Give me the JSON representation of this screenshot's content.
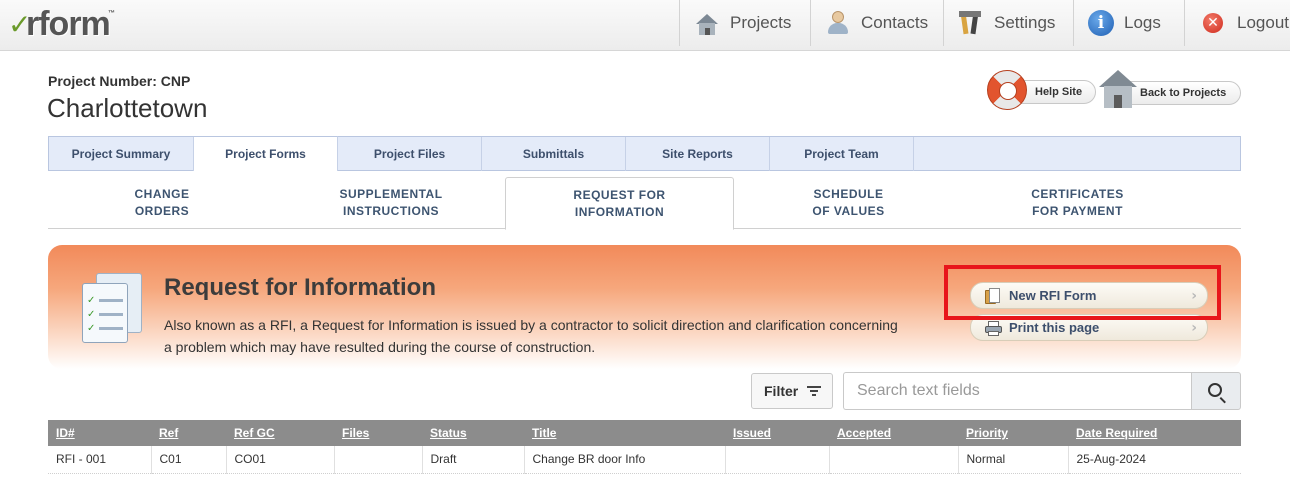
{
  "brand": {
    "name": "rform",
    "tm": "™"
  },
  "nav": [
    {
      "label": "Projects",
      "icon": "house-icon"
    },
    {
      "label": "Contacts",
      "icon": "person-icon"
    },
    {
      "label": "Settings",
      "icon": "tools-icon"
    },
    {
      "label": "Logs",
      "icon": "info-icon"
    },
    {
      "label": "Logout",
      "icon": "logout-icon"
    }
  ],
  "project": {
    "number_label": "Project Number: CNP",
    "name": "Charlottetown"
  },
  "header_buttons": {
    "help": "Help Site",
    "back": "Back to Projects"
  },
  "tabs": [
    {
      "label": "Project Summary"
    },
    {
      "label": "Project Forms"
    },
    {
      "label": "Project Files"
    },
    {
      "label": "Submittals"
    },
    {
      "label": "Site Reports"
    },
    {
      "label": "Project Team"
    }
  ],
  "subtabs": [
    {
      "line1": "CHANGE",
      "line2": "ORDERS"
    },
    {
      "line1": "SUPPLEMENTAL",
      "line2": "INSTRUCTIONS"
    },
    {
      "line1": "REQUEST FOR",
      "line2": "INFORMATION"
    },
    {
      "line1": "SCHEDULE",
      "line2": "OF VALUES"
    },
    {
      "line1": "CERTIFICATES",
      "line2": "FOR PAYMENT"
    }
  ],
  "banner": {
    "title": "Request for Information",
    "description": "Also known as a RFI, a Request for Information is issued by a contractor to solicit direction and clarification concerning a problem which may have resulted during the course of construction.",
    "new_button": "New RFI Form",
    "print_button": "Print this page"
  },
  "toolbar": {
    "filter_label": "Filter",
    "search_placeholder": "Search text fields"
  },
  "table": {
    "columns": [
      "ID#",
      "Ref",
      "Ref GC",
      "Files",
      "Status",
      "Title",
      "Issued",
      "Accepted",
      "Priority",
      "Date Required"
    ],
    "rows": [
      [
        "RFI - 001",
        "C01",
        "CO01",
        "",
        "Draft",
        "Change BR door Info",
        "",
        "",
        "Normal",
        "25-Aug-2024"
      ]
    ]
  },
  "colors": {
    "highlight": "#e8151b",
    "tab_bg": "#e4ebf9",
    "banner_top": "#f28a5a",
    "table_header": "#8c8c8c"
  }
}
